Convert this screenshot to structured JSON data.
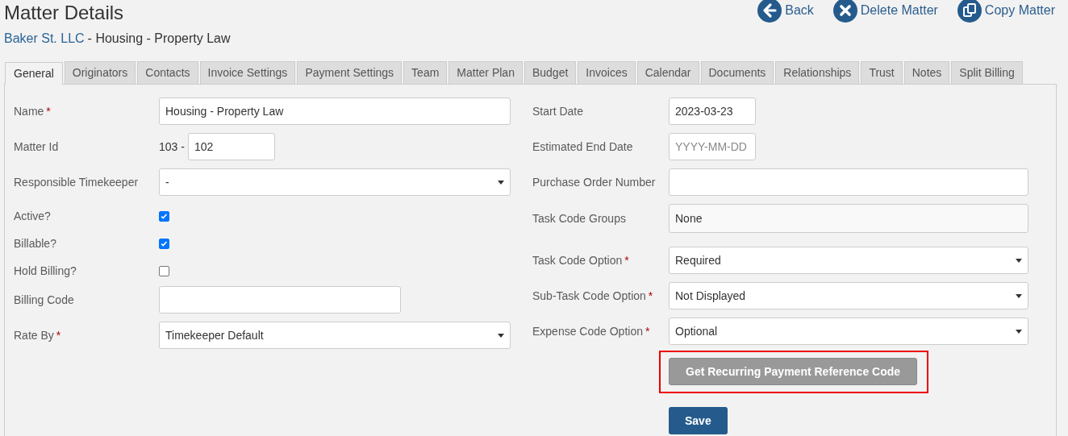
{
  "page": {
    "title": "Matter Details",
    "client": "Baker St. LLC",
    "matter": "- Housing - Property Law"
  },
  "actions": [
    {
      "kind": "back",
      "label": "Back"
    },
    {
      "kind": "delete",
      "label": "Delete Matter"
    },
    {
      "kind": "copy",
      "label": "Copy Matter"
    }
  ],
  "tabs": [
    {
      "label": "General",
      "selected": true
    },
    {
      "label": "Originators",
      "selected": false
    },
    {
      "label": "Contacts",
      "selected": false
    },
    {
      "label": "Invoice Settings",
      "selected": false
    },
    {
      "label": "Payment Settings",
      "selected": false
    },
    {
      "label": "Team",
      "selected": false
    },
    {
      "label": "Matter Plan",
      "selected": false
    },
    {
      "label": "Budget",
      "selected": false
    },
    {
      "label": "Invoices",
      "selected": false
    },
    {
      "label": "Calendar",
      "selected": false
    },
    {
      "label": "Documents",
      "selected": false
    },
    {
      "label": "Relationships",
      "selected": false
    },
    {
      "label": "Trust",
      "selected": false
    },
    {
      "label": "Notes",
      "selected": false
    },
    {
      "label": "Split Billing",
      "selected": false
    }
  ],
  "left_fields": [
    {
      "kind": "text",
      "label": "Name",
      "required_mark": "*",
      "value": "Housing - Property Law"
    },
    {
      "kind": "prefixed",
      "label": "Matter Id",
      "prefix": "103 -",
      "value": "102"
    },
    {
      "kind": "select",
      "label": "Responsible Timekeeper",
      "value": "-"
    },
    {
      "kind": "checkbox",
      "label": "Active?",
      "checked": true
    },
    {
      "kind": "checkbox",
      "label": "Billable?",
      "checked": true
    },
    {
      "kind": "checkbox",
      "label": "Hold Billing?",
      "checked": false
    },
    {
      "kind": "short_text",
      "label": "Billing Code"
    },
    {
      "kind": "select",
      "label": "Rate By",
      "required_mark": "*",
      "value": "Timekeeper Default"
    }
  ],
  "right_fields": [
    {
      "kind": "date",
      "label": "Start Date",
      "value": "2023-03-23"
    },
    {
      "kind": "date",
      "label": "Estimated End Date",
      "placeholder": "YYYY-MM-DD"
    },
    {
      "kind": "text",
      "label": "Purchase Order Number"
    },
    {
      "kind": "readonly",
      "label": "Task Code Groups",
      "value": "None"
    },
    {
      "kind": "select",
      "label": "Task Code Option",
      "required_mark": "*",
      "value": "Required"
    },
    {
      "kind": "select",
      "label": "Sub-Task Code Option",
      "required_mark": "*",
      "value": "Not Displayed"
    },
    {
      "kind": "select",
      "label": "Expense Code Option",
      "required_mark": "*",
      "value": "Optional"
    }
  ],
  "buttons": [
    {
      "kind": "secondary",
      "label": "Get Recurring Payment Reference Code",
      "highlighted": true
    },
    {
      "kind": "primary",
      "label": "Save",
      "highlighted": false
    }
  ]
}
